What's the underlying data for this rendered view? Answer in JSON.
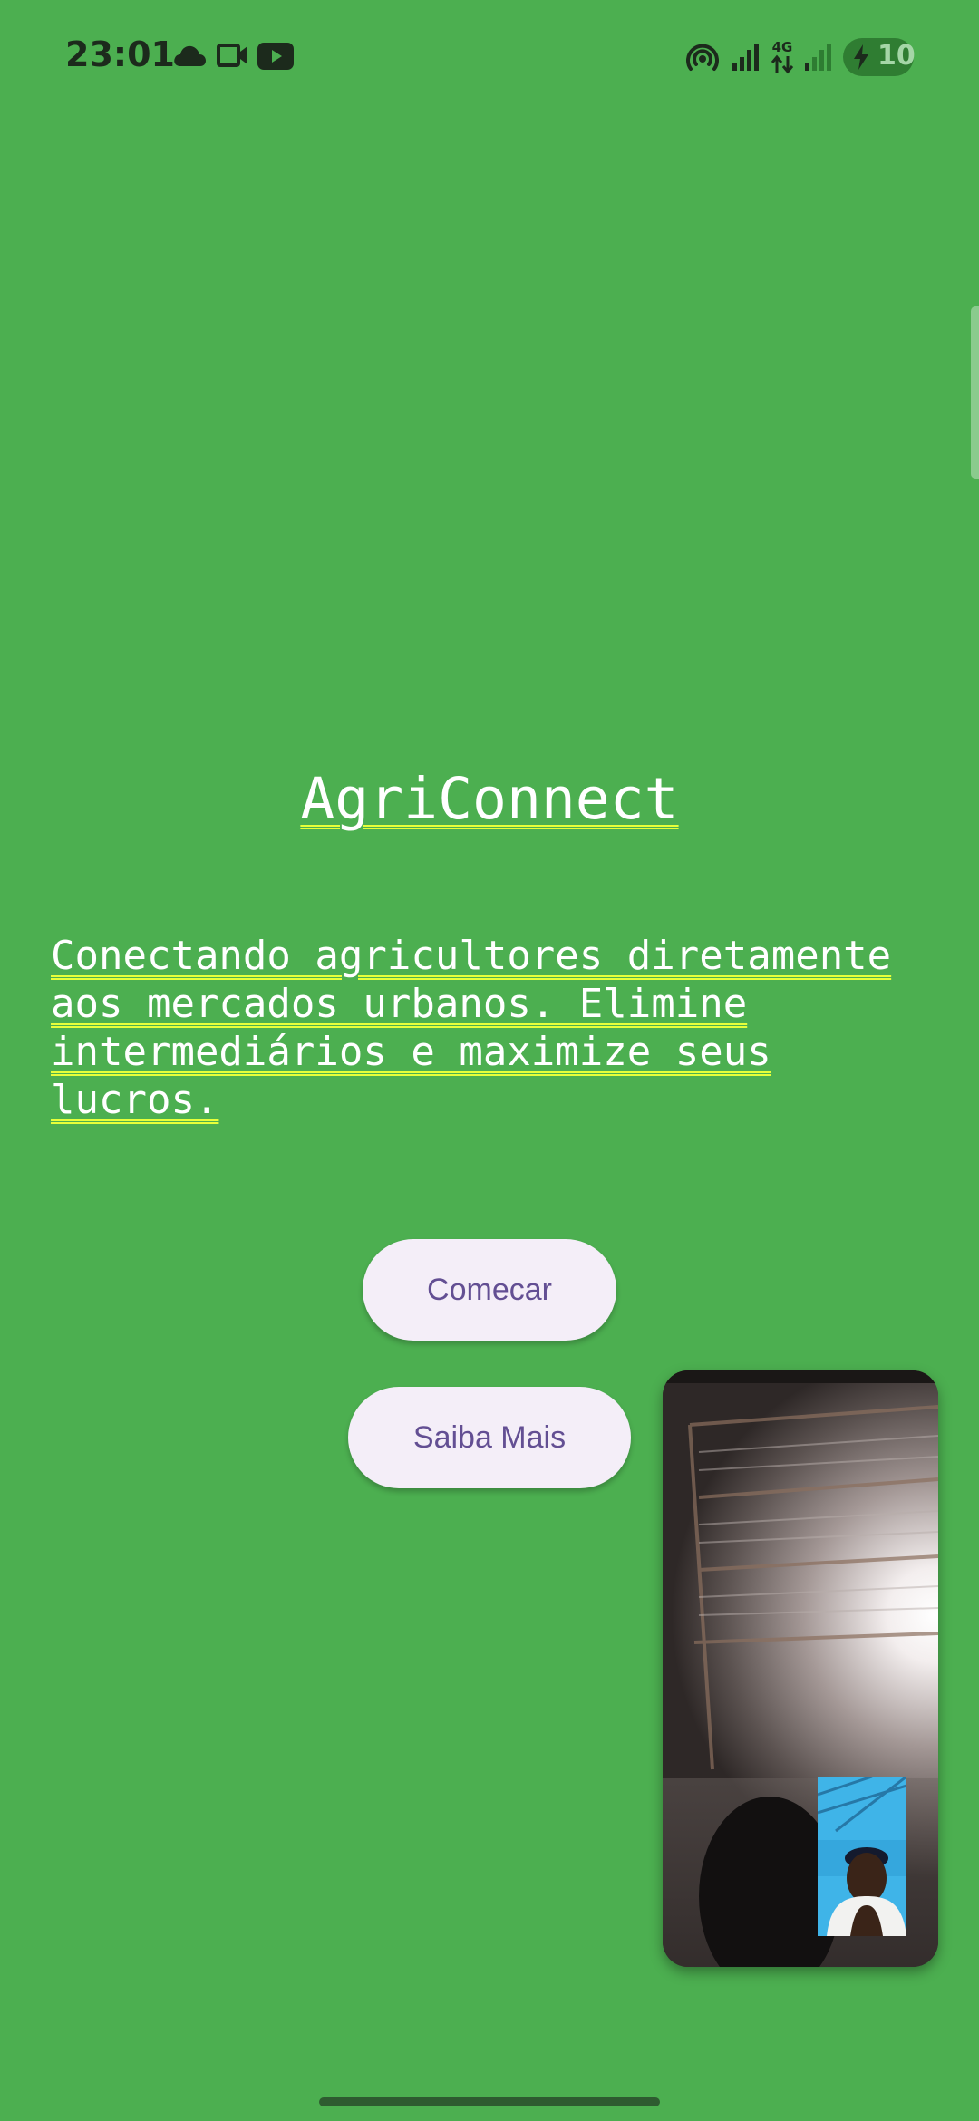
{
  "status_bar": {
    "time": "23:01",
    "left_icons": [
      "cloud-icon",
      "video-camera-icon",
      "youtube-icon"
    ],
    "right_icons": [
      "hotspot-icon",
      "signal-icon",
      "network-4g-icon",
      "signal-icon"
    ],
    "network_type": "4G",
    "battery_level": "10",
    "battery_charging": true
  },
  "main": {
    "title": "AgriConnect",
    "subtitle": "Conectando agricultores diretamente aos mercados urbanos. Elimine intermediários e maximize seus lucros.",
    "buttons": {
      "start_label": "Comecar",
      "learn_label": "Saiba Mais"
    }
  },
  "colors": {
    "background": "#4caf50",
    "button_bg": "#f4eef8",
    "button_text": "#634f93",
    "underline_accent": "#e7ff3a"
  }
}
